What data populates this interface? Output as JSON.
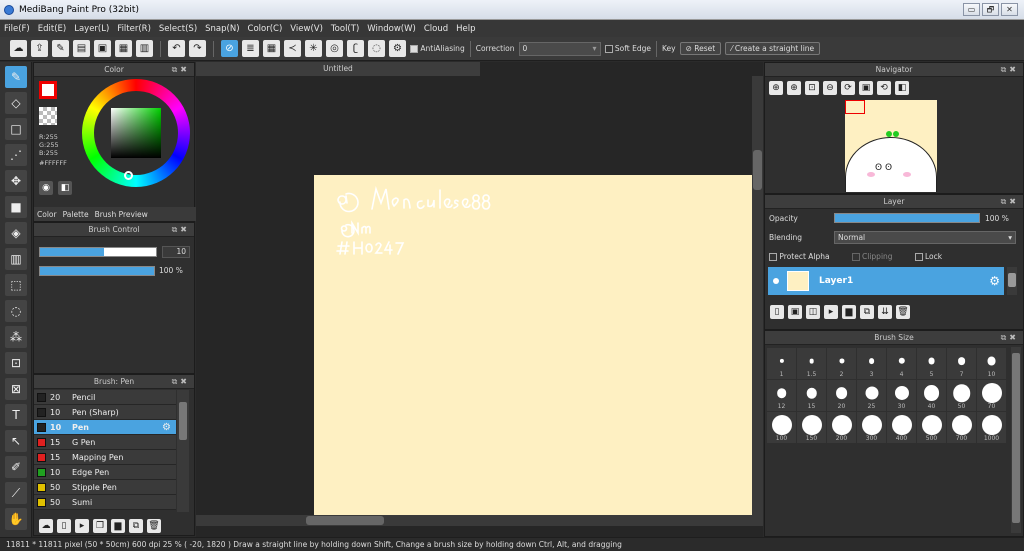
{
  "title": "MediBang Paint Pro (32bit)",
  "window_buttons": [
    "▭",
    "🗗",
    "✕"
  ],
  "menu": [
    "File(F)",
    "Edit(E)",
    "Layer(L)",
    "Filter(R)",
    "Select(S)",
    "Snap(N)",
    "Color(C)",
    "View(V)",
    "Tool(T)",
    "Window(W)",
    "Cloud",
    "Help"
  ],
  "toolbar": {
    "antialiasing": "AntiAliasing",
    "correction_label": "Correction",
    "correction_value": "0",
    "soft_edge": "Soft Edge",
    "key": "Key",
    "reset": "Reset",
    "straight_line": "Create a straight line"
  },
  "color_panel": {
    "title": "Color",
    "r": "R:255",
    "g": "G:255",
    "b": "B:255",
    "hex": "#FFFFFF",
    "tabs": [
      "Color",
      "Palette",
      "Brush Preview"
    ]
  },
  "brush_control": {
    "title": "Brush Control",
    "size": "10",
    "opacity": "100 %",
    "size_level": 0.55,
    "opacity_level": 1.0
  },
  "brush_list": {
    "title": "Brush: Pen",
    "items": [
      {
        "size": "20",
        "name": "Pencil",
        "color": "#222222"
      },
      {
        "size": "10",
        "name": "Pen (Sharp)",
        "color": "#222222"
      },
      {
        "size": "10",
        "name": "Pen",
        "color": "#222222",
        "selected": true
      },
      {
        "size": "15",
        "name": "G Pen",
        "color": "#e02020"
      },
      {
        "size": "15",
        "name": "Mapping Pen",
        "color": "#e02020"
      },
      {
        "size": "10",
        "name": "Edge Pen",
        "color": "#20a020"
      },
      {
        "size": "50",
        "name": "Stipple Pen",
        "color": "#e0c000"
      },
      {
        "size": "50",
        "name": "Sumi",
        "color": "#e0c000"
      }
    ]
  },
  "canvas": {
    "tab": "Untitled",
    "paper_color": "#fef0c2"
  },
  "navigator": {
    "title": "Navigator"
  },
  "layer_panel": {
    "title": "Layer",
    "opacity_label": "Opacity",
    "opacity_value": "100 %",
    "blending_label": "Blending",
    "blending_value": "Normal",
    "protect_alpha": "Protect Alpha",
    "clipping": "Clipping",
    "lock": "Lock",
    "layer_name": "Layer1"
  },
  "brush_size_panel": {
    "title": "Brush Size",
    "sizes": [
      "1",
      "1.5",
      "2",
      "3",
      "4",
      "5",
      "7",
      "10",
      "12",
      "15",
      "20",
      "25",
      "30",
      "40",
      "50",
      "70",
      "100",
      "150",
      "200",
      "300",
      "400",
      "500",
      "700",
      "1000"
    ]
  },
  "status": "11811 * 11811 pixel  (50 * 50cm)  600 dpi  25 %  ( -20, 1820 )  Draw a straight line by holding down Shift, Change a brush size by holding down Ctrl, Alt, and dragging"
}
